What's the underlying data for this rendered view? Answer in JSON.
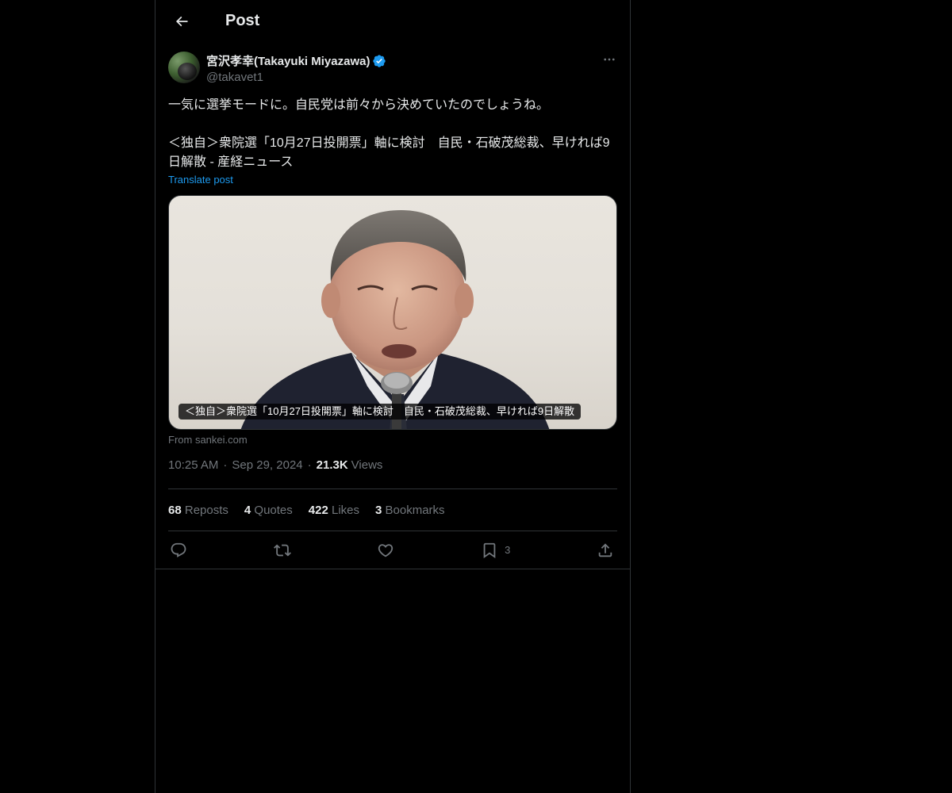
{
  "header": {
    "title": "Post"
  },
  "author": {
    "display_name": "宮沢孝幸(Takayuki Miyazawa)",
    "handle": "@takavet1",
    "verified": true
  },
  "post": {
    "text": "一気に選挙モードに。自民党は前々から決めていたのでしょうね。\n\n＜独自＞衆院選「10月27日投開票」軸に検討　自民・石破茂総裁、早ければ9日解散 - 産経ニュース",
    "translate_label": "Translate post"
  },
  "card": {
    "caption": "＜独自＞衆院選「10月27日投開票」軸に検討　自民・石破茂総裁、早ければ9日解散",
    "source": "From sankei.com"
  },
  "meta": {
    "time": "10:25 AM",
    "date": "Sep 29, 2024",
    "views_count": "21.3K",
    "views_label": "Views"
  },
  "stats": {
    "reposts_count": "68",
    "reposts_label": "Reposts",
    "quotes_count": "4",
    "quotes_label": "Quotes",
    "likes_count": "422",
    "likes_label": "Likes",
    "bookmarks_count": "3",
    "bookmarks_label": "Bookmarks"
  },
  "actions": {
    "reply": {
      "icon": "reply-icon"
    },
    "repost": {
      "icon": "repost-icon"
    },
    "like": {
      "icon": "heart-icon"
    },
    "bookmark": {
      "icon": "bookmark-icon",
      "count": "3"
    },
    "share": {
      "icon": "share-icon"
    }
  },
  "colors": {
    "background": "#000000",
    "text": "#e7e9ea",
    "muted": "#71767b",
    "accent": "#1d9bf0",
    "border": "#2f3336"
  }
}
